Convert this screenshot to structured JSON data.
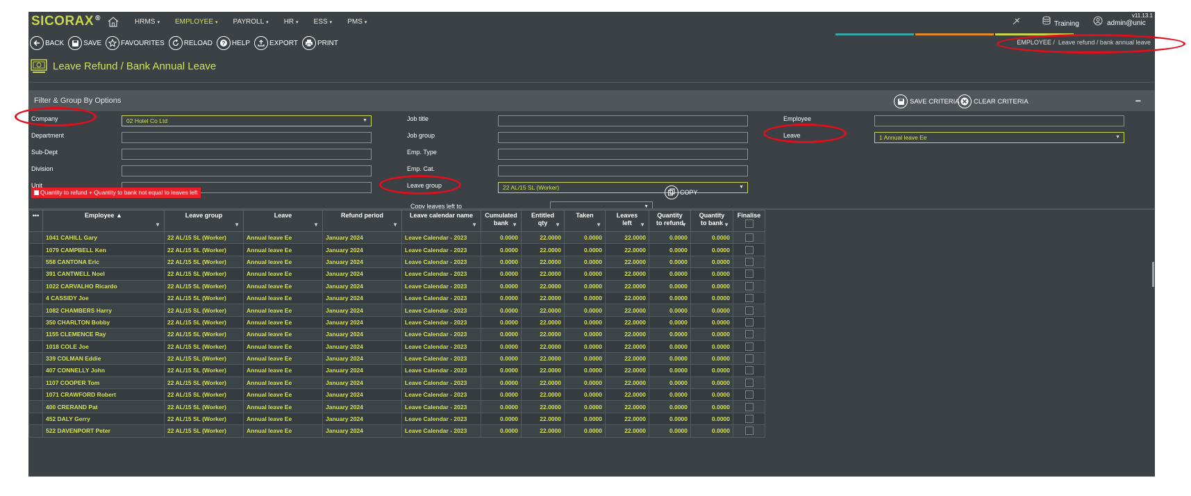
{
  "app": {
    "logo": "SICORAX",
    "logo_mark": "®",
    "version": "v11.13.1",
    "nav": [
      {
        "label": "HRMS",
        "active": false
      },
      {
        "label": "EMPLOYEE",
        "active": true
      },
      {
        "label": "PAYROLL",
        "active": false
      },
      {
        "label": "HR",
        "active": false
      },
      {
        "label": "ESS",
        "active": false
      },
      {
        "label": "PMS",
        "active": false
      }
    ],
    "right": {
      "db_label": "Training",
      "user_label": "admin@unic"
    },
    "accent_colors": [
      "#3aa6a8",
      "#e58a2a",
      "#c8d84a"
    ]
  },
  "toolbar": {
    "back": "BACK",
    "save": "SAVE",
    "favourites": "FAVOURITES",
    "reload": "RELOAD",
    "help": "HELP",
    "export": "EXPORT",
    "print": "PRINT"
  },
  "breadcrumb": {
    "parent": "EMPLOYEE",
    "separator": "/",
    "current": "Leave refund / bank annual leave"
  },
  "page_title": "Leave Refund / Bank Annual Leave",
  "filter": {
    "title": "Filter & Group By Options",
    "save_criteria": "SAVE CRITERIA",
    "clear_criteria": "CLEAR CRITERIA",
    "collapse": "−",
    "labels": {
      "company": "Company",
      "department": "Department",
      "sub_dept": "Sub-Dept",
      "division": "Division",
      "unit": "Unit",
      "job_title": "Job title",
      "job_group": "Job group",
      "emp_type": "Emp. Type",
      "emp_cat": "Emp. Cat.",
      "leave_group": "Leave group",
      "employee": "Employee",
      "leave": "Leave",
      "copy_leaves_left_to": "Copy leaves left to"
    },
    "values": {
      "company": "02 Hotel Co Ltd",
      "leave_group": "22 AL/15 SL (Worker)",
      "leave": "1 Annual leave Ee",
      "department": "",
      "sub_dept": "",
      "division": "",
      "unit": "",
      "job_title": "",
      "job_group": "",
      "emp_type": "",
      "emp_cat": "",
      "employee": "",
      "copy_leaves_left_to": ""
    },
    "warning": "Quantity to refund + Quantity to bank not equal to leaves left",
    "copy": "COPY"
  },
  "table": {
    "menu": "•••",
    "columns": [
      {
        "l1": "Employee ▲",
        "l2": ""
      },
      {
        "l1": "Leave group",
        "l2": ""
      },
      {
        "l1": "Leave",
        "l2": ""
      },
      {
        "l1": "Refund period",
        "l2": ""
      },
      {
        "l1": "Leave calendar name",
        "l2": ""
      },
      {
        "l1": "Cumulated",
        "l2": "bank"
      },
      {
        "l1": "Entitled",
        "l2": "qty"
      },
      {
        "l1": "Taken",
        "l2": ""
      },
      {
        "l1": "Leaves",
        "l2": "left"
      },
      {
        "l1": "Quantity",
        "l2": "to refund"
      },
      {
        "l1": "Quantity",
        "l2": "to bank"
      },
      {
        "l1": "Finalise",
        "l2": ""
      }
    ],
    "rows": [
      {
        "employee": "1041 CAHILL Gary",
        "leave_group": "22 AL/15 SL (Worker)",
        "leave": "Annual leave Ee",
        "refund_period": "January 2024",
        "calendar": "Leave Calendar - 2023",
        "cumulated_bank": "0.0000",
        "entitled_qty": "22.0000",
        "taken": "0.0000",
        "leaves_left": "22.0000",
        "qty_refund": "0.0000",
        "qty_bank": "0.0000"
      },
      {
        "employee": "1079 CAMPBELL Ken",
        "leave_group": "22 AL/15 SL (Worker)",
        "leave": "Annual leave Ee",
        "refund_period": "January 2024",
        "calendar": "Leave Calendar - 2023",
        "cumulated_bank": "0.0000",
        "entitled_qty": "22.0000",
        "taken": "0.0000",
        "leaves_left": "22.0000",
        "qty_refund": "0.0000",
        "qty_bank": "0.0000"
      },
      {
        "employee": "558 CANTONA Eric",
        "leave_group": "22 AL/15 SL (Worker)",
        "leave": "Annual leave Ee",
        "refund_period": "January 2024",
        "calendar": "Leave Calendar - 2023",
        "cumulated_bank": "0.0000",
        "entitled_qty": "22.0000",
        "taken": "0.0000",
        "leaves_left": "22.0000",
        "qty_refund": "0.0000",
        "qty_bank": "0.0000"
      },
      {
        "employee": "391 CANTWELL Noel",
        "leave_group": "22 AL/15 SL (Worker)",
        "leave": "Annual leave Ee",
        "refund_period": "January 2024",
        "calendar": "Leave Calendar - 2023",
        "cumulated_bank": "0.0000",
        "entitled_qty": "22.0000",
        "taken": "0.0000",
        "leaves_left": "22.0000",
        "qty_refund": "0.0000",
        "qty_bank": "0.0000"
      },
      {
        "employee": "1022 CARVALHO Ricardo",
        "leave_group": "22 AL/15 SL (Worker)",
        "leave": "Annual leave Ee",
        "refund_period": "January 2024",
        "calendar": "Leave Calendar - 2023",
        "cumulated_bank": "0.0000",
        "entitled_qty": "22.0000",
        "taken": "0.0000",
        "leaves_left": "22.0000",
        "qty_refund": "0.0000",
        "qty_bank": "0.0000"
      },
      {
        "employee": "4 CASSIDY Joe",
        "leave_group": "22 AL/15 SL (Worker)",
        "leave": "Annual leave Ee",
        "refund_period": "January 2024",
        "calendar": "Leave Calendar - 2023",
        "cumulated_bank": "0.0000",
        "entitled_qty": "22.0000",
        "taken": "0.0000",
        "leaves_left": "22.0000",
        "qty_refund": "0.0000",
        "qty_bank": "0.0000"
      },
      {
        "employee": "1082 CHAMBERS Harry",
        "leave_group": "22 AL/15 SL (Worker)",
        "leave": "Annual leave Ee",
        "refund_period": "January 2024",
        "calendar": "Leave Calendar - 2023",
        "cumulated_bank": "0.0000",
        "entitled_qty": "22.0000",
        "taken": "0.0000",
        "leaves_left": "22.0000",
        "qty_refund": "0.0000",
        "qty_bank": "0.0000"
      },
      {
        "employee": "350 CHARLTON Bobby",
        "leave_group": "22 AL/15 SL (Worker)",
        "leave": "Annual leave Ee",
        "refund_period": "January 2024",
        "calendar": "Leave Calendar - 2023",
        "cumulated_bank": "0.0000",
        "entitled_qty": "22.0000",
        "taken": "0.0000",
        "leaves_left": "22.0000",
        "qty_refund": "0.0000",
        "qty_bank": "0.0000"
      },
      {
        "employee": "1155 CLEMENCE Ray",
        "leave_group": "22 AL/15 SL (Worker)",
        "leave": "Annual leave Ee",
        "refund_period": "January 2024",
        "calendar": "Leave Calendar - 2023",
        "cumulated_bank": "0.0000",
        "entitled_qty": "22.0000",
        "taken": "0.0000",
        "leaves_left": "22.0000",
        "qty_refund": "0.0000",
        "qty_bank": "0.0000"
      },
      {
        "employee": "1018 COLE Joe",
        "leave_group": "22 AL/15 SL (Worker)",
        "leave": "Annual leave Ee",
        "refund_period": "January 2024",
        "calendar": "Leave Calendar - 2023",
        "cumulated_bank": "0.0000",
        "entitled_qty": "22.0000",
        "taken": "0.0000",
        "leaves_left": "22.0000",
        "qty_refund": "0.0000",
        "qty_bank": "0.0000"
      },
      {
        "employee": "339 COLMAN Eddie",
        "leave_group": "22 AL/15 SL (Worker)",
        "leave": "Annual leave Ee",
        "refund_period": "January 2024",
        "calendar": "Leave Calendar - 2023",
        "cumulated_bank": "0.0000",
        "entitled_qty": "22.0000",
        "taken": "0.0000",
        "leaves_left": "22.0000",
        "qty_refund": "0.0000",
        "qty_bank": "0.0000"
      },
      {
        "employee": "407 CONNELLY John",
        "leave_group": "22 AL/15 SL (Worker)",
        "leave": "Annual leave Ee",
        "refund_period": "January 2024",
        "calendar": "Leave Calendar - 2023",
        "cumulated_bank": "0.0000",
        "entitled_qty": "22.0000",
        "taken": "0.0000",
        "leaves_left": "22.0000",
        "qty_refund": "0.0000",
        "qty_bank": "0.0000"
      },
      {
        "employee": "1107 COOPER Tom",
        "leave_group": "22 AL/15 SL (Worker)",
        "leave": "Annual leave Ee",
        "refund_period": "January 2024",
        "calendar": "Leave Calendar - 2023",
        "cumulated_bank": "0.0000",
        "entitled_qty": "22.0000",
        "taken": "0.0000",
        "leaves_left": "22.0000",
        "qty_refund": "0.0000",
        "qty_bank": "0.0000"
      },
      {
        "employee": "1071 CRAWFORD Robert",
        "leave_group": "22 AL/15 SL (Worker)",
        "leave": "Annual leave Ee",
        "refund_period": "January 2024",
        "calendar": "Leave Calendar - 2023",
        "cumulated_bank": "0.0000",
        "entitled_qty": "22.0000",
        "taken": "0.0000",
        "leaves_left": "22.0000",
        "qty_refund": "0.0000",
        "qty_bank": "0.0000"
      },
      {
        "employee": "400 CRERAND Pat",
        "leave_group": "22 AL/15 SL (Worker)",
        "leave": "Annual leave Ee",
        "refund_period": "January 2024",
        "calendar": "Leave Calendar - 2023",
        "cumulated_bank": "0.0000",
        "entitled_qty": "22.0000",
        "taken": "0.0000",
        "leaves_left": "22.0000",
        "qty_refund": "0.0000",
        "qty_bank": "0.0000"
      },
      {
        "employee": "452 DALY Gerry",
        "leave_group": "22 AL/15 SL (Worker)",
        "leave": "Annual leave Ee",
        "refund_period": "January 2024",
        "calendar": "Leave Calendar - 2023",
        "cumulated_bank": "0.0000",
        "entitled_qty": "22.0000",
        "taken": "0.0000",
        "leaves_left": "22.0000",
        "qty_refund": "0.0000",
        "qty_bank": "0.0000"
      },
      {
        "employee": "522 DAVENPORT Peter",
        "leave_group": "22 AL/15 SL (Worker)",
        "leave": "Annual leave Ee",
        "refund_period": "January 2024",
        "calendar": "Leave Calendar - 2023",
        "cumulated_bank": "0.0000",
        "entitled_qty": "22.0000",
        "taken": "0.0000",
        "leaves_left": "22.0000",
        "qty_refund": "0.0000",
        "qty_bank": "0.0000"
      }
    ]
  },
  "annotation_color": "#e30e1b"
}
